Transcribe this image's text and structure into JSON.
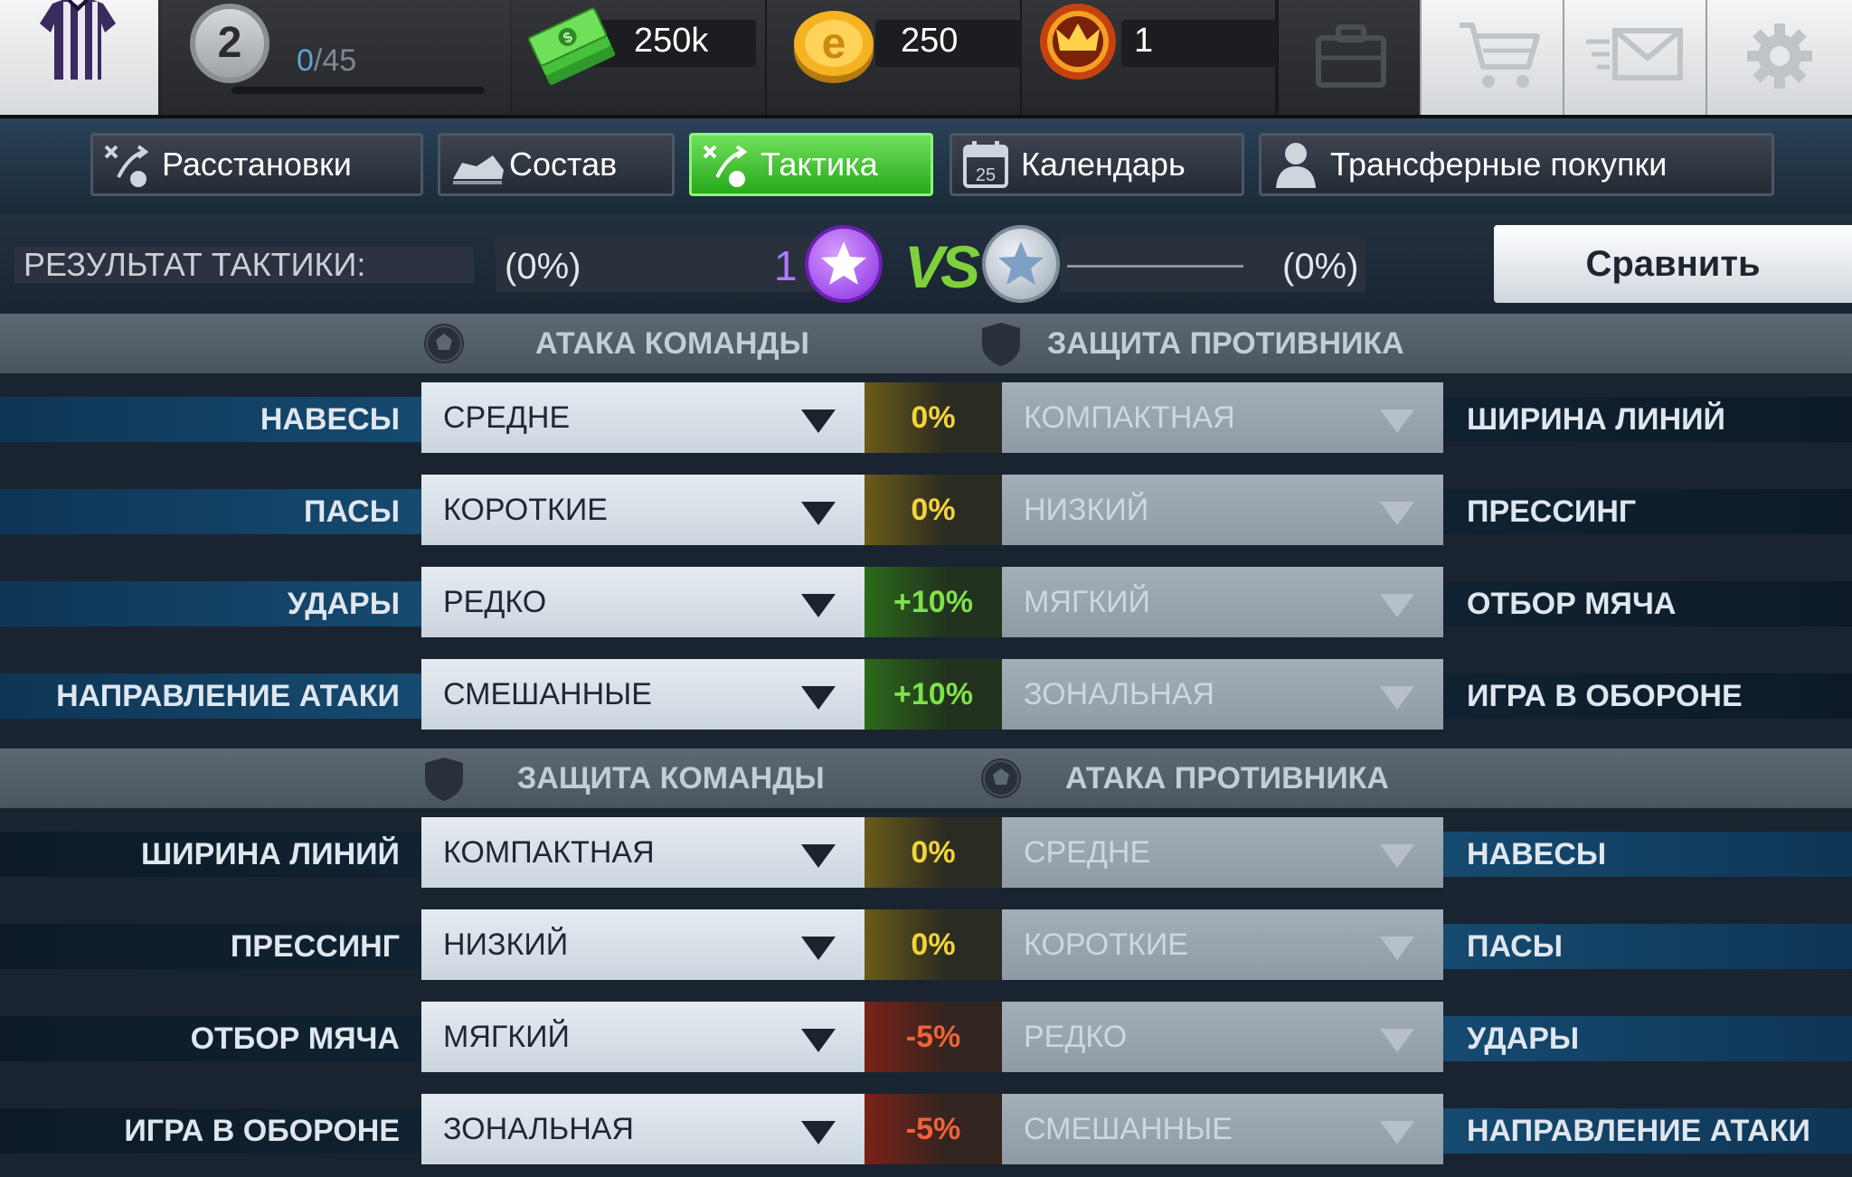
{
  "header": {
    "level": "2",
    "progress_current": "0",
    "progress_total": "/45",
    "cash": "250k",
    "coins": "250",
    "crowns": "1"
  },
  "icons": {
    "jersey": "jersey-icon",
    "cash": "cash-icon",
    "coin": "coin-icon",
    "crown": "crown-icon",
    "briefcase": "briefcase-icon",
    "cart": "cart-icon",
    "mail": "mail-icon",
    "settings": "gear-icon"
  },
  "tabs": [
    {
      "label": "Расстановки",
      "active": false
    },
    {
      "label": "Состав",
      "active": false
    },
    {
      "label": "Тактика",
      "active": true
    },
    {
      "label": "Календарь",
      "active": false,
      "calendar_day": "25"
    },
    {
      "label": "Трансферные покупки",
      "active": false
    }
  ],
  "result": {
    "label": "РЕЗУЛЬТАТ ТАКТИКИ:",
    "left_pct": "(0%)",
    "left_count": "1",
    "vs": "VS",
    "right_pct": "(0%)",
    "compare_label": "Сравнить"
  },
  "sections": {
    "attack": {
      "left": "АТАКА КОМАНДЫ",
      "right": "ЗАЩИТА ПРОТИВНИКА"
    },
    "defense": {
      "left": "ЗАЩИТА КОМАНДЫ",
      "right": "АТАКА ПРОТИВНИКА"
    }
  },
  "attack_rows": [
    {
      "label": "НАВЕСЫ",
      "value": "СРЕДНЕ",
      "pct": "0%",
      "pct_kind": "zero",
      "opp_value": "КОМПАКТНАЯ",
      "opp_label": "ШИРИНА ЛИНИЙ"
    },
    {
      "label": "ПАСЫ",
      "value": "КОРОТКИЕ",
      "pct": "0%",
      "pct_kind": "zero",
      "opp_value": "НИЗКИЙ",
      "opp_label": "ПРЕССИНГ"
    },
    {
      "label": "УДАРЫ",
      "value": "РЕДКО",
      "pct": "+10%",
      "pct_kind": "plus",
      "opp_value": "МЯГКИЙ",
      "opp_label": "ОТБОР МЯЧА"
    },
    {
      "label": "НАПРАВЛЕНИЕ АТАКИ",
      "value": "СМЕШАННЫЕ",
      "pct": "+10%",
      "pct_kind": "plus",
      "opp_value": "ЗОНАЛЬНАЯ",
      "opp_label": "ИГРА В ОБОРОНЕ"
    }
  ],
  "defense_rows": [
    {
      "label": "ШИРИНА ЛИНИЙ",
      "value": "КОМПАКТНАЯ",
      "pct": "0%",
      "pct_kind": "zero",
      "opp_value": "СРЕДНЕ",
      "opp_label": "НАВЕСЫ"
    },
    {
      "label": "ПРЕССИНГ",
      "value": "НИЗКИЙ",
      "pct": "0%",
      "pct_kind": "zero",
      "opp_value": "КОРОТКИЕ",
      "opp_label": "ПАСЫ"
    },
    {
      "label": "ОТБОР МЯЧА",
      "value": "МЯГКИЙ",
      "pct": "-5%",
      "pct_kind": "minus",
      "opp_value": "РЕДКО",
      "opp_label": "УДАРЫ"
    },
    {
      "label": "ИГРА В ОБОРОНЕ",
      "value": "ЗОНАЛЬНАЯ",
      "pct": "-5%",
      "pct_kind": "minus",
      "opp_value": "СМЕШАННЫЕ",
      "opp_label": "НАПРАВЛЕНИЕ АТАКИ"
    }
  ],
  "colors": {
    "active_tab": "#3cc22a",
    "zero_pct": "#f3d33b",
    "plus_pct": "#7ee24a",
    "minus_pct": "#f06238",
    "player_star": "#a44ef0"
  }
}
